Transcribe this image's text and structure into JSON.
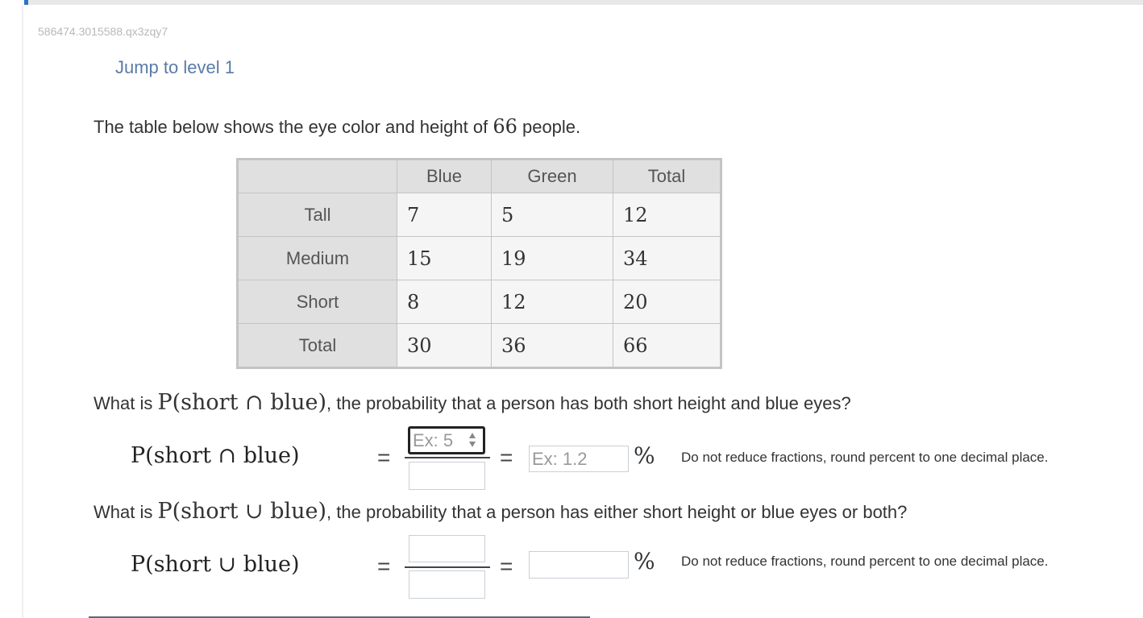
{
  "question_id": "586474.3015588.qx3zqy7",
  "jump_link": "Jump to level 1",
  "intro": {
    "prefix": "The table below shows the eye color and height of ",
    "count": "66",
    "suffix": " people."
  },
  "table": {
    "columns": [
      "",
      "Blue",
      "Green",
      "Total"
    ],
    "rows": [
      {
        "label": "Tall",
        "values": [
          "7",
          "5",
          "12"
        ]
      },
      {
        "label": "Medium",
        "values": [
          "15",
          "19",
          "34"
        ]
      },
      {
        "label": "Short",
        "values": [
          "8",
          "12",
          "20"
        ]
      },
      {
        "label": "Total",
        "values": [
          "30",
          "36",
          "66"
        ]
      }
    ]
  },
  "q1": {
    "prefix": "What is ",
    "expr": "P(short ∩ blue)",
    "suffix": ", the probability that a person has both short height and blue eyes?",
    "label": "P(short ∩ blue)",
    "equals": "=",
    "numerator_placeholder": "Ex: 5",
    "numerator_value": "",
    "denominator_value": "",
    "percent_placeholder": "Ex: 1.2",
    "percent_value": "",
    "percent_sign": "%",
    "note": "Do not reduce fractions, round percent to one decimal place."
  },
  "q2": {
    "prefix": "What is ",
    "expr": "P(short ∪ blue)",
    "suffix": ", the probability that a person has either short height or blue eyes or both?",
    "label": "P(short ∪ blue)",
    "equals": "=",
    "numerator_value": "",
    "denominator_value": "",
    "percent_value": "",
    "percent_sign": "%",
    "note": "Do not reduce fractions, round percent to one decimal place."
  }
}
